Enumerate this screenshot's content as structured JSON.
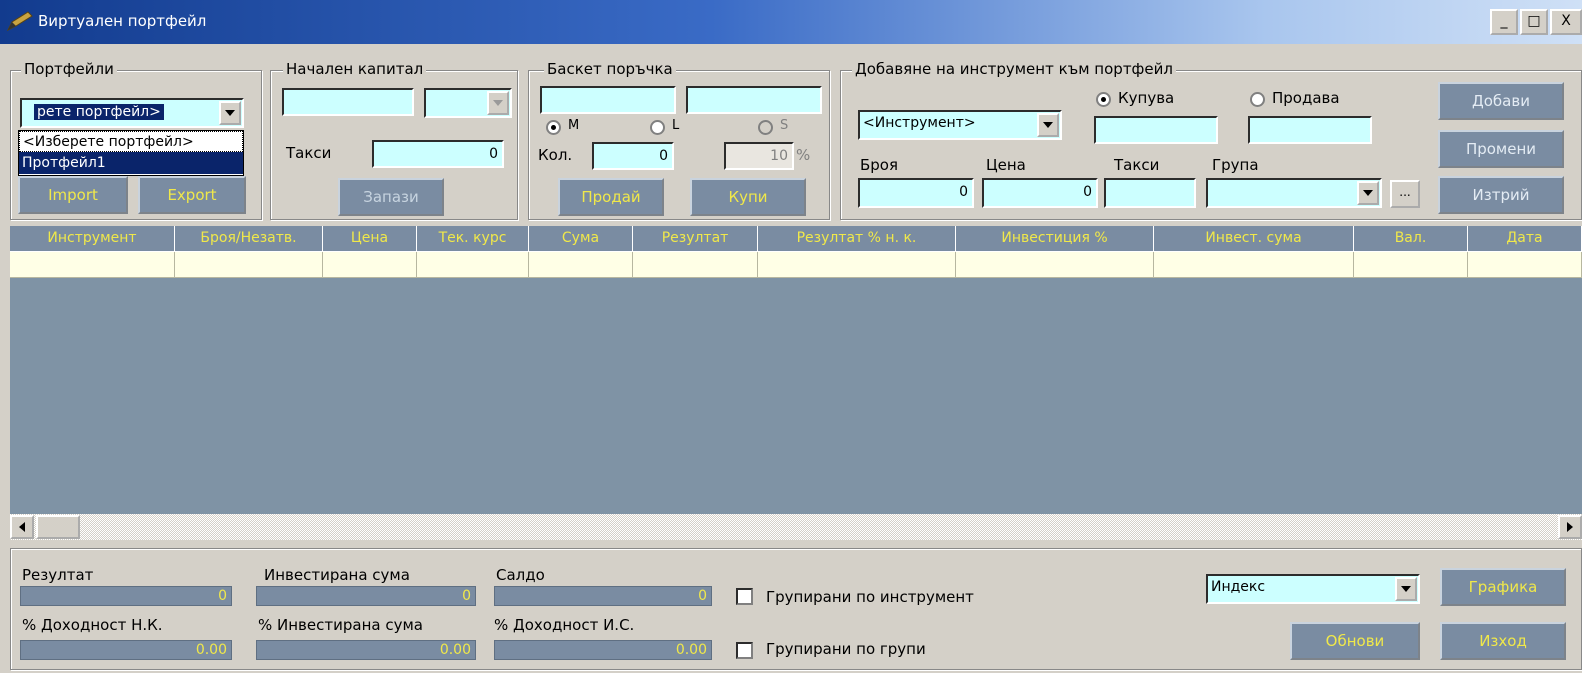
{
  "window": {
    "title": "Виртуален портфейл",
    "title_buttons": [
      "_",
      "□",
      "X"
    ]
  },
  "portfolios": {
    "legend": "Портфейли",
    "combo_value": "рете портфейл>",
    "dropdown_items": [
      "<Изберете портфейл>",
      "Протфейл1"
    ],
    "import_label": "Import",
    "export_label": "Export"
  },
  "capital": {
    "legend": "Начален капитал",
    "capital_value": "",
    "currency_value": "",
    "fees_label": "Такси",
    "fees_value": "0",
    "save_label": "Запази"
  },
  "basket": {
    "legend": "Баскет поръчка",
    "field1": "",
    "field2": "",
    "radio_m": "M",
    "radio_l": "L",
    "radio_s": "S",
    "qty_label": "Кол.",
    "qty_value": "0",
    "pct_value": "10",
    "pct_sign": "%",
    "sell_label": "Продай",
    "buy_label": "Купи"
  },
  "add_instrument": {
    "legend": "Добавяне на инструмент към портфейл",
    "instrument_combo": "<Инструмент>",
    "buy_radio": "Купува",
    "sell_radio": "Продава",
    "count_label": "Броя",
    "count_value": "0",
    "price_label": "Цена",
    "price_value": "0",
    "fees_label": "Такси",
    "fees_value": "",
    "group_label": "Група",
    "group_value": "",
    "ellipsis_label": "...",
    "add_label": "Добави",
    "change_label": "Промени",
    "delete_label": "Изтрий"
  },
  "grid": {
    "columns": [
      "Инструмент",
      "Броя/Незатв.",
      "Цена",
      "Тек. курс",
      "Сума",
      "Резултат",
      "Резултат % н. к.",
      "Инвестиция %",
      "Инвест. сума",
      "Вал.",
      "Дата"
    ]
  },
  "summary": {
    "result_label": "Резултат",
    "result_value": "0",
    "invested_label": "Инвестирана сума",
    "invested_value": "0",
    "balance_label": "Салдо",
    "balance_value": "0",
    "yield_nk_label": "% Доходност Н.К.",
    "yield_nk_value": "0.00",
    "invested_pct_label": "% Инвестирана сума",
    "invested_pct_value": "0.00",
    "yield_is_label": "% Доходност И.С.",
    "yield_is_value": "0.00",
    "group_by_instrument": "Групирани по инструмент",
    "group_by_groups": "Групирани по групи",
    "index_combo": "Индекс",
    "chart_label": "Графика",
    "refresh_label": "Обнови",
    "exit_label": "Изход"
  },
  "colors": {
    "accent_button": "#7a8ca2",
    "button_text": "#f0e84a",
    "input_bg": "#ccffff",
    "grid_bg": "#7f93a5",
    "row_bg": "#ffffe6"
  }
}
